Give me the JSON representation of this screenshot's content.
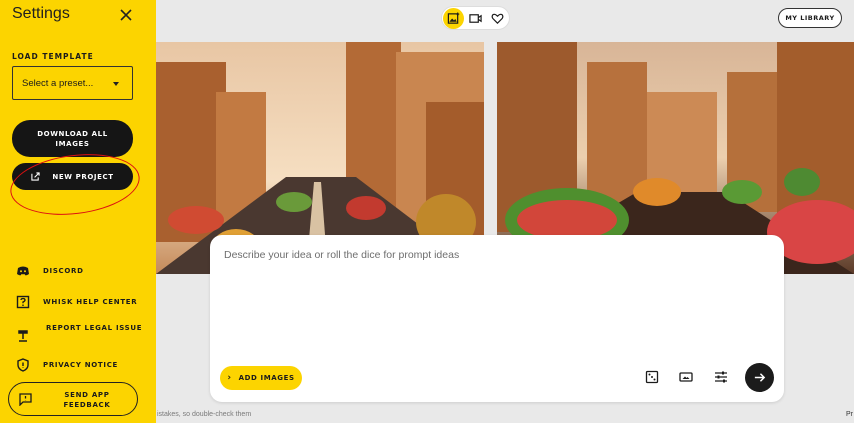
{
  "sidebar": {
    "title": "Settings",
    "load_template_label": "LOAD TEMPLATE",
    "preset_value": "Select a preset...",
    "download_all_label": "DOWNLOAD ALL IMAGES",
    "new_project_label": "NEW PROJECT",
    "nav": [
      {
        "label": "DISCORD",
        "icon": "discord-icon"
      },
      {
        "label": "WHISK HELP CENTER",
        "icon": "help-center-icon"
      },
      {
        "label": "REPORT LEGAL ISSUE",
        "icon": "gavel-icon"
      },
      {
        "label": "PRIVACY NOTICE",
        "icon": "shield-icon"
      }
    ],
    "feedback_label": "SEND APP FEEDBACK"
  },
  "topbar": {
    "modes": [
      "image-add-icon",
      "video-icon",
      "heart-icon"
    ],
    "my_library_label": "MY LIBRARY"
  },
  "prompt": {
    "placeholder": "Describe your idea or roll the dice for prompt ideas",
    "add_images_label": "ADD IMAGES",
    "tools": [
      "dice-icon",
      "aspect-ratio-icon",
      "tune-icon"
    ]
  },
  "footer": {
    "disclaimer": "istakes, so double-check them",
    "edge_text": "Pr"
  },
  "colors": {
    "accent": "#fcd400",
    "dark": "#151515",
    "annotation": "#dd1111"
  }
}
